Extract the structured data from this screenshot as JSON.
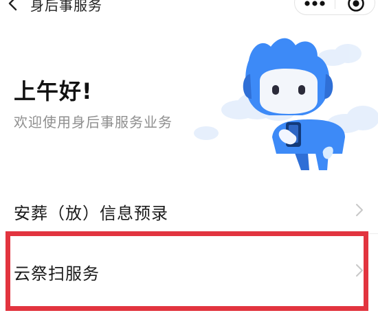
{
  "nav": {
    "title": "身后事服务",
    "back_icon": "chevron-left-icon",
    "more_icon": "more-dots-icon",
    "close_icon": "target-close-icon"
  },
  "greeting": {
    "title": "上午好!",
    "subtitle": "欢迎使用身后事服务业务"
  },
  "menu": {
    "items": [
      {
        "label": "安葬（放）信息预录",
        "icon": "chevron-right-icon"
      },
      {
        "label": "云祭扫服务",
        "icon": "chevron-right-icon"
      }
    ]
  },
  "colors": {
    "mascot_blue": "#3d8af7",
    "highlight_red": "#e2343f",
    "subtitle_gray": "#8e8e8e"
  }
}
